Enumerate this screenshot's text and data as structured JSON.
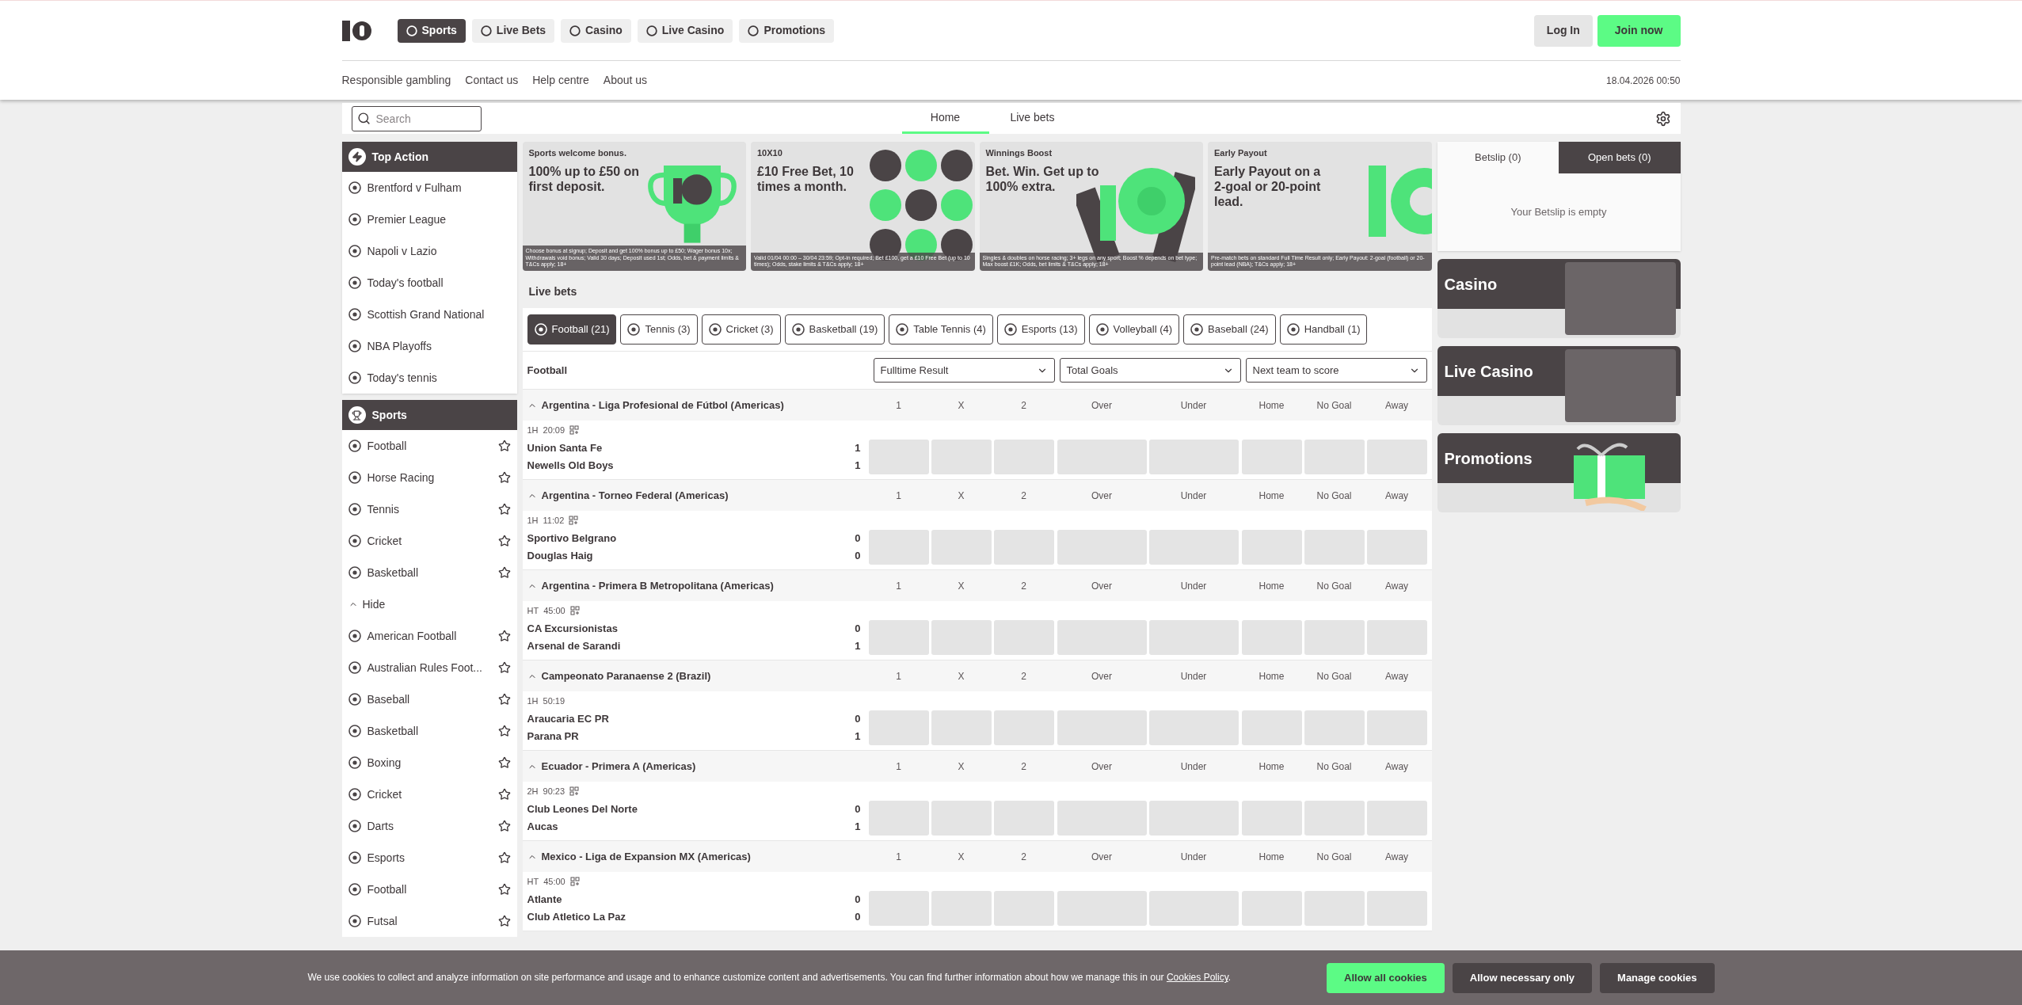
{
  "nav": [
    {
      "label": "Sports",
      "selected": true
    },
    {
      "label": "Live Bets",
      "selected": false
    },
    {
      "label": "Casino",
      "selected": false
    },
    {
      "label": "Live Casino",
      "selected": false
    },
    {
      "label": "Promotions",
      "selected": false
    }
  ],
  "auth": {
    "login": "Log In",
    "join": "Join now"
  },
  "links": [
    "Responsible gambling",
    "Contact us",
    "Help centre",
    "About us"
  ],
  "datetime": "18.04.2026 00:50",
  "search": {
    "placeholder": "Search"
  },
  "tabs": [
    {
      "label": "Home",
      "selected": true
    },
    {
      "label": "Live bets",
      "selected": false
    }
  ],
  "top_action": {
    "title": "Top Action",
    "items": [
      "Brentford v Fulham",
      "Premier League",
      "Napoli v Lazio",
      "Today's football",
      "Scottish Grand National",
      "NBA Playoffs",
      "Today's tennis"
    ]
  },
  "sports": {
    "title": "Sports",
    "items": [
      {
        "kind": "sport",
        "label": "Football"
      },
      {
        "kind": "sport",
        "label": "Horse Racing"
      },
      {
        "kind": "sport",
        "label": "Tennis"
      },
      {
        "kind": "sport",
        "label": "Cricket"
      },
      {
        "kind": "sport",
        "label": "Basketball"
      },
      {
        "kind": "toggle",
        "label": "Hide"
      },
      {
        "kind": "sport",
        "label": "American Football"
      },
      {
        "kind": "sport",
        "label": "Australian Rules Foot..."
      },
      {
        "kind": "sport",
        "label": "Baseball"
      },
      {
        "kind": "sport",
        "label": "Basketball"
      },
      {
        "kind": "sport",
        "label": "Boxing"
      },
      {
        "kind": "sport",
        "label": "Cricket"
      },
      {
        "kind": "sport",
        "label": "Darts"
      },
      {
        "kind": "sport",
        "label": "Esports"
      },
      {
        "kind": "sport",
        "label": "Football"
      },
      {
        "kind": "sport",
        "label": "Futsal"
      }
    ]
  },
  "banners": [
    {
      "eyebrow": "Sports welcome bonus.",
      "headline": "100% up to £50 on first deposit.",
      "terms": "Choose bonus at signup; Deposit and get 100% bonus up to £50; Wager bonus 10x; Withdrawals void bonus; Valid 30 days; Deposit used 1st; Odds, bet & payment limits & T&Cs apply; 18+"
    },
    {
      "eyebrow": "10X10",
      "headline": "£10 Free Bet, 10 times a month.",
      "terms": "Valid 01/04 00:00 – 30/04 23:59; Opt-in required; Bet £100, get a £10 Free Bet (up to 10 times); Odds, stake limits & T&Cs apply; 18+"
    },
    {
      "eyebrow": "Winnings Boost",
      "headline": "Bet. Win. Get up to 100% extra.",
      "terms": "Singles & doubles on horse racing; 3+ legs on any sport; Boost % depends on bet type; Max boost £1K; Odds, bet limits & T&Cs apply; 18+"
    },
    {
      "eyebrow": "Early Payout",
      "headline": "Early Payout on a 2-goal or 20-point lead.",
      "terms": "Pre-match bets on standard Full Time Result only; Early Payout: 2-goal (football) or 20-point lead (NBA); T&Cs apply; 18+"
    }
  ],
  "live_bets": {
    "title": "Live bets",
    "filters": [
      {
        "label": "Football (21)",
        "selected": true
      },
      {
        "label": "Tennis (3)",
        "selected": false
      },
      {
        "label": "Cricket (3)",
        "selected": false
      },
      {
        "label": "Basketball (19)",
        "selected": false
      },
      {
        "label": "Table Tennis (4)",
        "selected": false
      },
      {
        "label": "Esports (13)",
        "selected": false
      },
      {
        "label": "Volleyball (4)",
        "selected": false
      },
      {
        "label": "Baseball (24)",
        "selected": false
      },
      {
        "label": "Handball (1)",
        "selected": false
      }
    ],
    "sport": "Football",
    "markets": [
      "Fulltime Result",
      "Total Goals",
      "Next team to score"
    ],
    "groups": [
      {
        "league": "Argentina - Liga Profesional de Fútbol (Americas)",
        "expanded": true,
        "columns": [
          "1",
          "X",
          "2",
          "Over",
          "Under",
          "Home",
          "No Goal",
          "Away"
        ],
        "matches": [
          {
            "period": "1H",
            "clock": "20:09",
            "stats": true,
            "teams": [
              {
                "name": "Union Santa Fe",
                "score": "1"
              },
              {
                "name": "Newells Old Boys",
                "score": "1"
              }
            ]
          }
        ]
      },
      {
        "league": "Argentina - Torneo Federal (Americas)",
        "expanded": true,
        "columns": [
          "1",
          "X",
          "2",
          "Over",
          "Under",
          "Home",
          "No Goal",
          "Away"
        ],
        "matches": [
          {
            "period": "1H",
            "clock": "11:02",
            "stats": true,
            "teams": [
              {
                "name": "Sportivo Belgrano",
                "score": "0"
              },
              {
                "name": "Douglas Haig",
                "score": "0"
              }
            ]
          }
        ]
      },
      {
        "league": "Argentina - Primera B Metropolitana (Americas)",
        "expanded": true,
        "columns": [
          "1",
          "X",
          "2",
          "Over",
          "Under",
          "Home",
          "No Goal",
          "Away"
        ],
        "matches": [
          {
            "period": "HT",
            "clock": "45:00",
            "stats": true,
            "teams": [
              {
                "name": "CA Excursionistas",
                "score": "0"
              },
              {
                "name": "Arsenal de Sarandi",
                "score": "1"
              }
            ]
          }
        ]
      },
      {
        "league": "Campeonato Paranaense 2 (Brazil)",
        "expanded": true,
        "columns": [
          "1",
          "X",
          "2",
          "Over",
          "Under",
          "Home",
          "No Goal",
          "Away"
        ],
        "matches": [
          {
            "period": "1H",
            "clock": "50:19",
            "stats": false,
            "teams": [
              {
                "name": "Araucaria EC PR",
                "score": "0"
              },
              {
                "name": "Parana PR",
                "score": "1"
              }
            ]
          }
        ]
      },
      {
        "league": "Ecuador - Primera A (Americas)",
        "expanded": true,
        "columns": [
          "1",
          "X",
          "2",
          "Over",
          "Under",
          "Home",
          "No Goal",
          "Away"
        ],
        "matches": [
          {
            "period": "2H",
            "clock": "90:23",
            "stats": true,
            "teams": [
              {
                "name": "Club Leones Del Norte",
                "score": "0"
              },
              {
                "name": "Aucas",
                "score": "1"
              }
            ]
          }
        ]
      },
      {
        "league": "Mexico - Liga de Expansion MX (Americas)",
        "expanded": true,
        "columns": [
          "1",
          "X",
          "2",
          "Over",
          "Under",
          "Home",
          "No Goal",
          "Away"
        ],
        "matches": [
          {
            "period": "HT",
            "clock": "45:00",
            "stats": true,
            "teams": [
              {
                "name": "Atlante",
                "score": "0"
              },
              {
                "name": "Club Atletico La Paz",
                "score": "0"
              }
            ]
          }
        ]
      }
    ]
  },
  "betslip": {
    "tabs": [
      {
        "label": "Betslip (0)",
        "selected": true
      },
      {
        "label": "Open bets (0)",
        "selected": false
      }
    ],
    "empty": "Your Betslip is empty"
  },
  "promos": [
    "Casino",
    "Live Casino",
    "Promotions"
  ],
  "cookies": {
    "text": "We use cookies to collect and analyze information on site performance and usage and to enhance customize content and advertisements. You can find further information about how we manage this in our ",
    "link": "Cookies Policy",
    "after": ".",
    "buttons": [
      {
        "kind": "primary",
        "label": "Allow all cookies"
      },
      {
        "kind": "secondary",
        "label": "Allow necessary only"
      },
      {
        "kind": "secondary",
        "label": "Manage cookies"
      }
    ]
  }
}
